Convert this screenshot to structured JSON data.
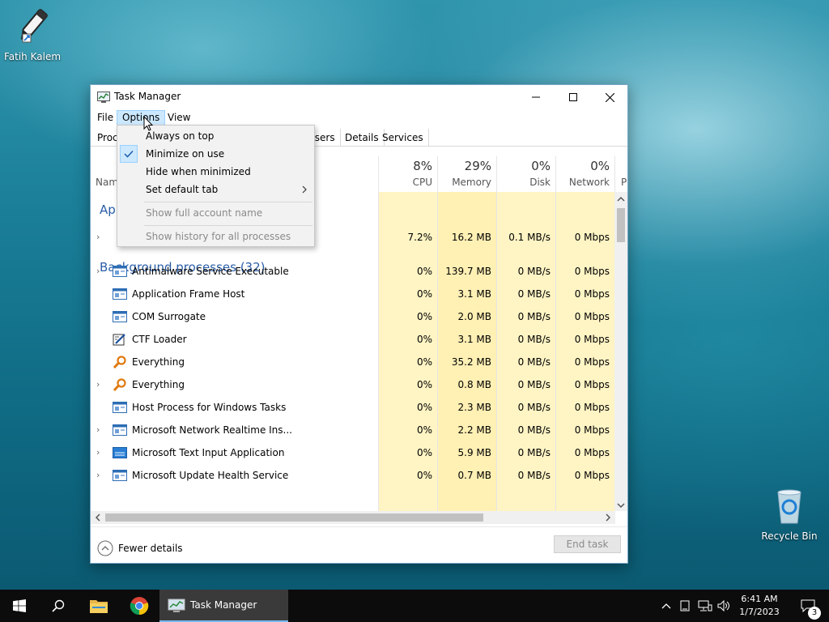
{
  "desktop": {
    "icons": [
      {
        "label": "Fatih Kalem"
      },
      {
        "label": "Recycle Bin"
      }
    ]
  },
  "window": {
    "title": "Task Manager",
    "menu": {
      "file": "File",
      "options": "Options",
      "view": "View"
    },
    "tabs": {
      "processes": "Proc",
      "users": "Users",
      "details": "Details",
      "services": "Services"
    },
    "columns": {
      "name": "Nam",
      "cpu": {
        "pct": "8%",
        "label": "CPU"
      },
      "memory": {
        "pct": "29%",
        "label": "Memory"
      },
      "disk": {
        "pct": "0%",
        "label": "Disk"
      },
      "network": {
        "pct": "0%",
        "label": "Network"
      },
      "power": "P"
    },
    "apps_group": "App",
    "apps_row": {
      "cpu": "7.2%",
      "memory": "16.2 MB",
      "disk": "0.1 MB/s",
      "network": "0 Mbps"
    },
    "background_group": "Background processes (32)",
    "rows": [
      {
        "name": "Antimalware Service Executable",
        "cpu": "0%",
        "memory": "139.7 MB",
        "disk": "0 MB/s",
        "network": "0 Mbps"
      },
      {
        "name": "Application Frame Host",
        "cpu": "0%",
        "memory": "3.1 MB",
        "disk": "0 MB/s",
        "network": "0 Mbps"
      },
      {
        "name": "COM Surrogate",
        "cpu": "0%",
        "memory": "2.0 MB",
        "disk": "0 MB/s",
        "network": "0 Mbps"
      },
      {
        "name": "CTF Loader",
        "cpu": "0%",
        "memory": "3.1 MB",
        "disk": "0 MB/s",
        "network": "0 Mbps"
      },
      {
        "name": "Everything",
        "cpu": "0%",
        "memory": "35.2 MB",
        "disk": "0 MB/s",
        "network": "0 Mbps"
      },
      {
        "name": "Everything",
        "cpu": "0%",
        "memory": "0.8 MB",
        "disk": "0 MB/s",
        "network": "0 Mbps"
      },
      {
        "name": "Host Process for Windows Tasks",
        "cpu": "0%",
        "memory": "2.3 MB",
        "disk": "0 MB/s",
        "network": "0 Mbps"
      },
      {
        "name": "Microsoft Network Realtime Ins...",
        "cpu": "0%",
        "memory": "2.2 MB",
        "disk": "0 MB/s",
        "network": "0 Mbps"
      },
      {
        "name": "Microsoft Text Input Application",
        "cpu": "0%",
        "memory": "5.9 MB",
        "disk": "0 MB/s",
        "network": "0 Mbps"
      },
      {
        "name": "Microsoft Update Health Service",
        "cpu": "0%",
        "memory": "0.7 MB",
        "disk": "0 MB/s",
        "network": "0 Mbps"
      }
    ],
    "footer": {
      "fewer_details": "Fewer details",
      "end_task": "End task"
    }
  },
  "options_menu": {
    "items": [
      {
        "label": "Always on top",
        "checked": false,
        "disabled": false
      },
      {
        "label": "Minimize on use",
        "checked": true,
        "disabled": false
      },
      {
        "label": "Hide when minimized",
        "checked": false,
        "disabled": false
      },
      {
        "label": "Set default tab",
        "submenu": true,
        "disabled": false
      },
      {
        "label": "Show full account name",
        "disabled": true
      },
      {
        "label": "Show history for all processes",
        "disabled": true
      }
    ]
  },
  "taskbar": {
    "active_app": "Task Manager",
    "time": "6:41 AM",
    "date": "1/7/2023",
    "notification_count": "3"
  },
  "colors": {
    "accent": "#0078d7",
    "heat": "#fff4c4",
    "group_text": "#2a5ea8"
  }
}
